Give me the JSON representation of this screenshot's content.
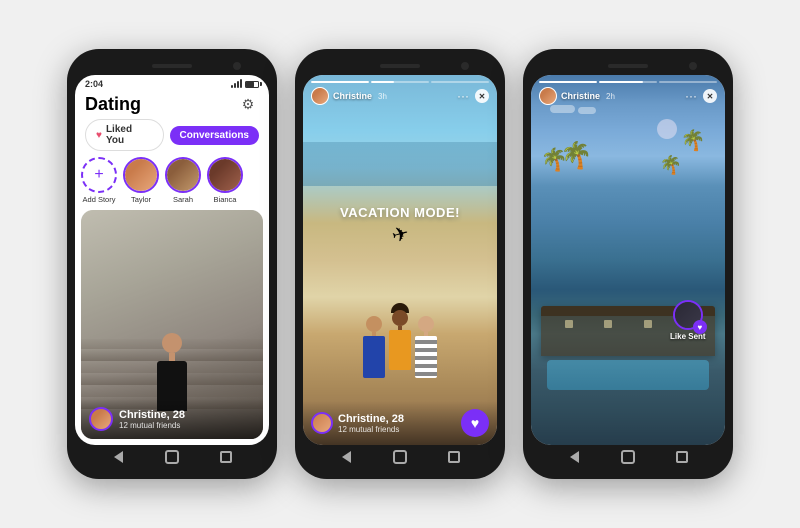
{
  "app": {
    "title": "Dating"
  },
  "phone1": {
    "status_time": "2:04",
    "header_title": "Dating",
    "tab_liked": "Liked You",
    "tab_conversations": "Conversations",
    "story_add_label": "Add Story",
    "story1_label": "Taylor",
    "story2_label": "Sarah",
    "story3_label": "Bianca",
    "profile_name": "Christine, 28",
    "profile_mutual": "12 mutual friends"
  },
  "phone2": {
    "story_user": "Christine",
    "story_time": "3h",
    "story_text_line1": "VACATION MODE!",
    "story_plane": "✈",
    "profile_name": "Christine, 28",
    "profile_mutual": "12 mutual friends"
  },
  "phone3": {
    "story_user": "Christine",
    "story_time": "2h",
    "like_sent_label": "Like Sent",
    "heart_icon": "♥",
    "dots_icon": "···",
    "close_icon": "✕"
  },
  "nav": {
    "back_title": "back",
    "home_title": "home",
    "recent_title": "recent"
  },
  "icons": {
    "gear": "⚙",
    "heart": "♥",
    "plus": "+",
    "dots": "···",
    "close": "✕",
    "airplane": "✈️"
  },
  "colors": {
    "purple": "#7b2ff7",
    "heart_red": "#e84d6e",
    "white": "#ffffff",
    "dark": "#1a1a1a"
  }
}
